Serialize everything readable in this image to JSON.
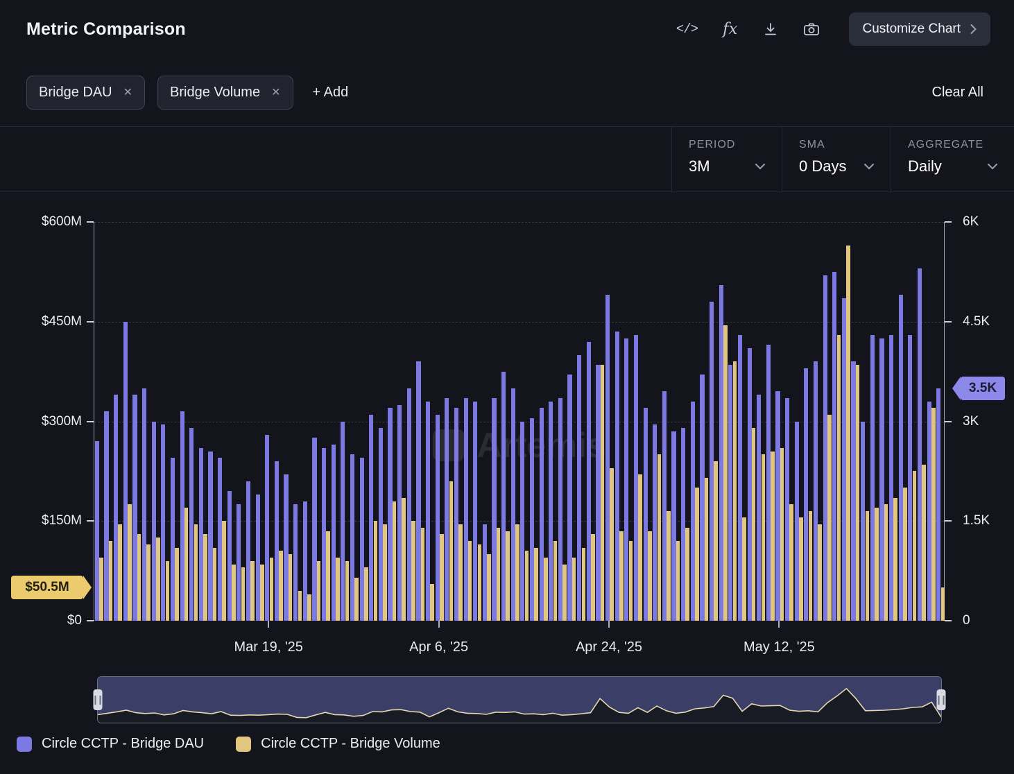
{
  "header": {
    "title": "Metric Comparison",
    "customize_button": "Customize Chart"
  },
  "icons": {
    "embed": "</>",
    "formula": "fx",
    "close": "✕"
  },
  "filters": {
    "chips": [
      {
        "label": "Bridge DAU"
      },
      {
        "label": "Bridge Volume"
      }
    ],
    "add_label": "+ Add",
    "clear_all": "Clear All"
  },
  "controls": [
    {
      "label": "PERIOD",
      "value": "3M"
    },
    {
      "label": "SMA",
      "value": "0 Days"
    },
    {
      "label": "AGGREGATE",
      "value": "Daily"
    }
  ],
  "watermark": {
    "text": "Artemis"
  },
  "legend": [
    {
      "label": "Circle CCTP - Bridge DAU",
      "color": "#7c79e2"
    },
    {
      "label": "Circle CCTP - Bridge Volume",
      "color": "#e0c67e"
    }
  ],
  "chart_data": {
    "type": "bar",
    "title": "Metric Comparison",
    "x_ticks": [
      {
        "index": 18,
        "label": "Mar 19, '25"
      },
      {
        "index": 36,
        "label": "Apr 6, '25"
      },
      {
        "index": 54,
        "label": "Apr 24, '25"
      },
      {
        "index": 72,
        "label": "May 12, '25"
      }
    ],
    "left_axis": {
      "min": 0,
      "max": 600,
      "unit": "$M",
      "ticks": [
        "$0",
        "$150M",
        "$300M",
        "$450M",
        "$600M"
      ],
      "grid_values": [
        150,
        300,
        450,
        600
      ]
    },
    "right_axis": {
      "min": 0,
      "max": 6000,
      "unit": "users",
      "ticks": [
        "0",
        "1.5K",
        "3K",
        "4.5K",
        "6K"
      ]
    },
    "series": [
      {
        "name": "Circle CCTP - Bridge DAU",
        "axis": "right",
        "color": "#7c79e2",
        "values": [
          2700,
          3150,
          3400,
          4500,
          3400,
          3500,
          3000,
          2950,
          2450,
          3150,
          2900,
          2600,
          2550,
          2450,
          1950,
          1750,
          2100,
          1900,
          2800,
          2400,
          2200,
          1750,
          1800,
          2750,
          2600,
          2650,
          3000,
          2500,
          2450,
          3100,
          2900,
          3200,
          3250,
          3500,
          3900,
          3300,
          3100,
          3350,
          3200,
          3350,
          3300,
          1450,
          3350,
          3750,
          3500,
          3000,
          3050,
          3200,
          3300,
          3350,
          3700,
          4000,
          4200,
          3850,
          4900,
          4350,
          4250,
          4300,
          3200,
          2950,
          3450,
          2850,
          2900,
          3300,
          3700,
          4800,
          5050,
          3850,
          4300,
          4100,
          3400,
          4150,
          3450,
          3350,
          3000,
          3800,
          3900,
          5200,
          5250,
          4850,
          3900,
          3000,
          4300,
          4250,
          4300,
          4900,
          4300,
          5300,
          3300,
          3500
        ]
      },
      {
        "name": "Circle CCTP - Bridge Volume",
        "axis": "left",
        "color": "#e0c67e",
        "values": [
          95,
          120,
          145,
          175,
          130,
          115,
          125,
          90,
          110,
          170,
          145,
          130,
          110,
          150,
          85,
          80,
          90,
          85,
          95,
          105,
          100,
          45,
          40,
          90,
          135,
          95,
          90,
          65,
          80,
          150,
          145,
          180,
          185,
          150,
          140,
          55,
          130,
          210,
          145,
          120,
          115,
          100,
          140,
          135,
          145,
          105,
          110,
          95,
          120,
          85,
          95,
          110,
          130,
          385,
          230,
          135,
          120,
          220,
          135,
          250,
          165,
          120,
          140,
          200,
          215,
          240,
          445,
          390,
          155,
          290,
          250,
          255,
          260,
          175,
          155,
          165,
          145,
          310,
          430,
          565,
          385,
          165,
          170,
          175,
          185,
          200,
          225,
          235,
          320,
          50.5
        ]
      }
    ],
    "last_value_tags": {
      "left": "$50.5M",
      "right": "3.5K"
    }
  }
}
